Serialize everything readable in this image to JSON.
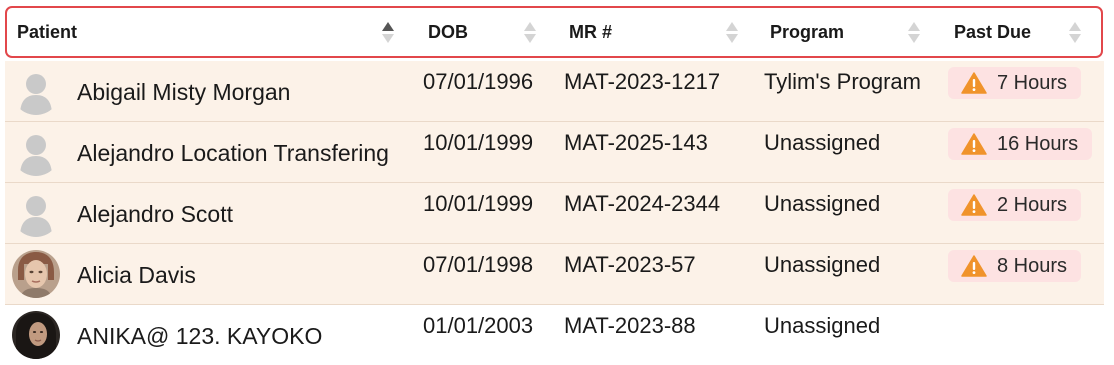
{
  "table": {
    "columns": [
      {
        "label": "Patient",
        "sort": "ascending"
      },
      {
        "label": "DOB",
        "sort": "none"
      },
      {
        "label": "MR #",
        "sort": "none"
      },
      {
        "label": "Program",
        "sort": "none"
      },
      {
        "label": "Past Due",
        "sort": "none"
      }
    ],
    "rows": [
      {
        "name": "Abigail Misty Morgan",
        "dob": "07/01/1996",
        "mr": "MAT-2023-1217",
        "program": "Tylim's Program",
        "past_due": "7 Hours",
        "avatar": "placeholder-avatar-icon",
        "highlight": true
      },
      {
        "name": "Alejandro Location Transfering",
        "dob": "10/01/1999",
        "mr": "MAT-2025-143",
        "program": "Unassigned",
        "past_due": "16 Hours",
        "avatar": "placeholder-avatar-icon",
        "highlight": true
      },
      {
        "name": "Alejandro Scott",
        "dob": "10/01/1999",
        "mr": "MAT-2024-2344",
        "program": "Unassigned",
        "past_due": "2 Hours",
        "avatar": "placeholder-avatar-icon",
        "highlight": true
      },
      {
        "name": "Alicia Davis",
        "dob": "07/01/1998",
        "mr": "MAT-2023-57",
        "program": "Unassigned",
        "past_due": "8 Hours",
        "avatar": "photo-avatar",
        "highlight": true
      },
      {
        "name": "ANIKA@ 123. KAYOKO",
        "dob": "01/01/2003",
        "mr": "MAT-2023-88",
        "program": "Unassigned",
        "past_due": "",
        "avatar": "photo-avatar",
        "highlight": false
      }
    ]
  },
  "colors": {
    "header_border": "#e2474b",
    "row_highlight": "#fcf2e8",
    "badge_bg": "#fde2e2",
    "warning_icon": "#f0932b"
  }
}
